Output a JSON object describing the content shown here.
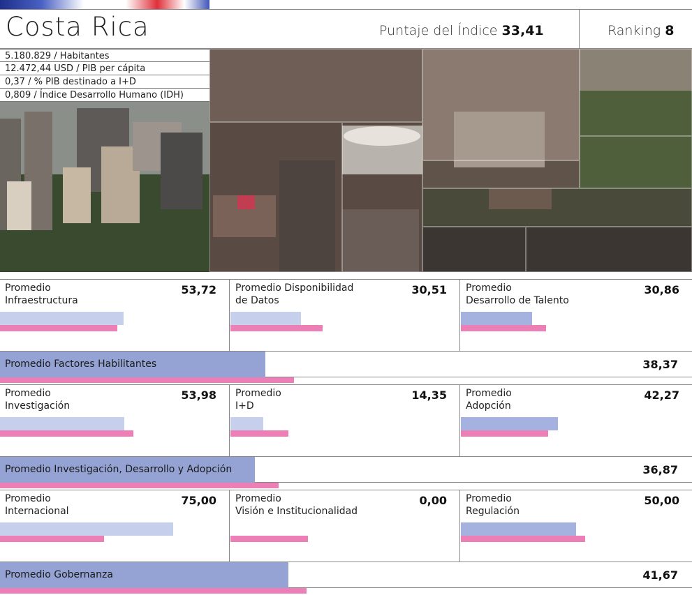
{
  "country": "Costa Rica",
  "score": {
    "label": "Puntaje del Índice",
    "value": "33,41"
  },
  "ranking": {
    "label": "Ranking",
    "value": "8"
  },
  "stats": [
    "5.180.829 / Habitantes",
    "12.472,44 USD / PIB per cápita",
    "0,37 / % PIB destinado a I+D",
    "0,809 / Índice Desarrollo Humano (IDH)"
  ],
  "colors": {
    "lavender": "#c6d0ec",
    "blue": "#a5b2df",
    "pink": "#ec7fb5",
    "avg_blue": "#94a3d3"
  },
  "sections": [
    {
      "cards": [
        {
          "label1": "Promedio",
          "label2": "Infraestructura",
          "value": "53,72",
          "country_pct": 53.72,
          "ref_pct": 51
        },
        {
          "label1": "Promedio Disponibilidad",
          "label2": "de Datos",
          "value": "30,51",
          "country_pct": 30.51,
          "ref_pct": 40
        },
        {
          "label1": "Promedio",
          "label2": "Desarrollo de Talento",
          "value": "30,86",
          "country_pct": 30.86,
          "ref_pct": 37
        }
      ],
      "avg": {
        "label": "Promedio Factores Habilitantes",
        "value": "38,37",
        "country_pct": 38.37,
        "ref_pct": 42.5
      }
    },
    {
      "cards": [
        {
          "label1": "Promedio",
          "label2": "Investigación",
          "value": "53,98",
          "country_pct": 53.98,
          "ref_pct": 58
        },
        {
          "label1": "Promedio",
          "label2": "I+D",
          "value": "14,35",
          "country_pct": 14.35,
          "ref_pct": 25
        },
        {
          "label1": "Promedio",
          "label2": "Adopción",
          "value": "42,27",
          "country_pct": 42.27,
          "ref_pct": 38
        }
      ],
      "avg": {
        "label": "Promedio Investigación, Desarrollo y Adopción",
        "value": "36,87",
        "country_pct": 36.87,
        "ref_pct": 40.3
      }
    },
    {
      "cards": [
        {
          "label1": "Promedio",
          "label2": "Internacional",
          "value": "75,00",
          "country_pct": 75.0,
          "ref_pct": 45
        },
        {
          "label1": "Promedio",
          "label2": "Visión e Institucionalidad",
          "value": "0,00",
          "country_pct": 0.0,
          "ref_pct": 33.5
        },
        {
          "label1": "Promedio",
          "label2": "Regulación",
          "value": "50,00",
          "country_pct": 50.0,
          "ref_pct": 54
        }
      ],
      "avg": {
        "label": "Promedio Gobernanza",
        "value": "41,67",
        "country_pct": 41.67,
        "ref_pct": 44.3
      }
    }
  ]
}
